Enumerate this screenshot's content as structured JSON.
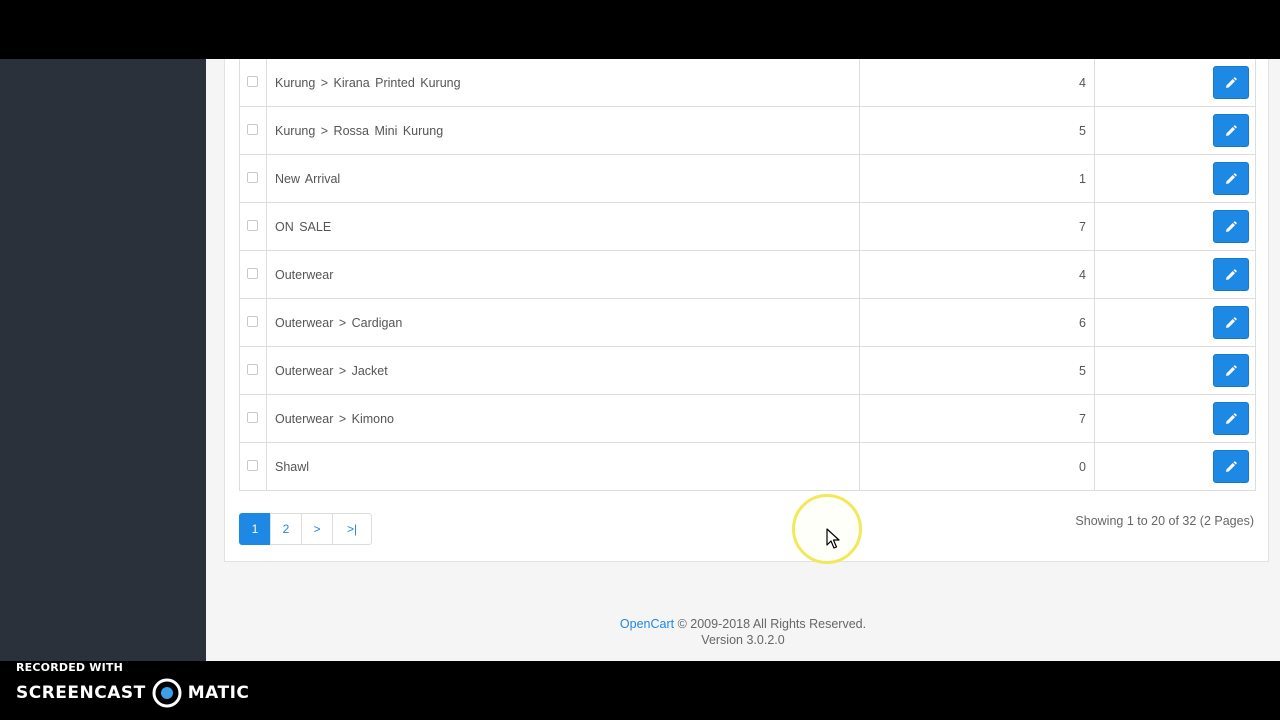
{
  "categories": [
    {
      "name": "Kurung  >  Kirana Printed Kurung",
      "sort_order": "4"
    },
    {
      "name": "Kurung  >  Rossa Mini Kurung",
      "sort_order": "5"
    },
    {
      "name": "New Arrival",
      "sort_order": "1"
    },
    {
      "name": "ON SALE",
      "sort_order": "7"
    },
    {
      "name": "Outerwear",
      "sort_order": "4"
    },
    {
      "name": "Outerwear  >  Cardigan",
      "sort_order": "6"
    },
    {
      "name": "Outerwear  >  Jacket",
      "sort_order": "5"
    },
    {
      "name": "Outerwear  >  Kimono",
      "sort_order": "7"
    },
    {
      "name": "Shawl",
      "sort_order": "0"
    }
  ],
  "pagination": {
    "pages": [
      "1",
      "2",
      ">",
      ">|"
    ],
    "active": "1",
    "showing": "Showing 1 to 20 of 32 (2 Pages)"
  },
  "footer": {
    "brand": "OpenCart",
    "copyright": "© 2009-2018 All Rights Reserved.",
    "version": "Version 3.0.2.0"
  },
  "watermark": {
    "recorded_with": "RECORDED WITH",
    "brand_left": "SCREENCAST",
    "brand_right": "MATIC"
  },
  "icons": {
    "edit": "pencil-icon"
  },
  "colors": {
    "primary": "#1e88e5",
    "sidebar": "#2b313b"
  }
}
